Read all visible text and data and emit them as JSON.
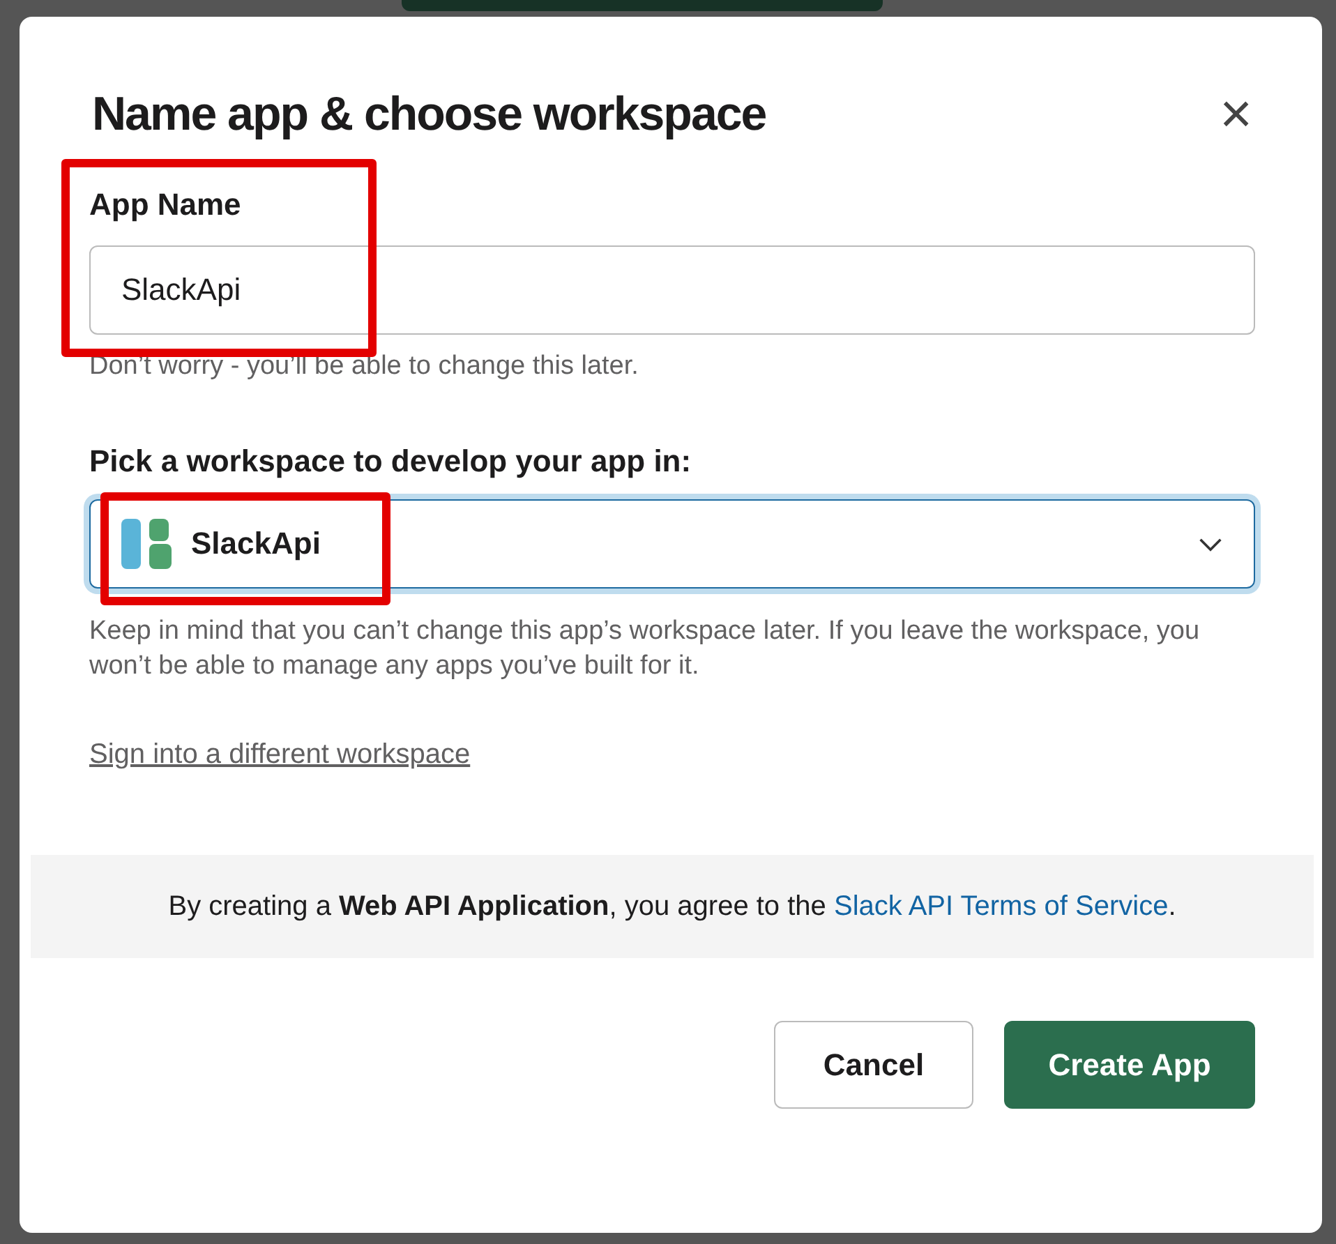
{
  "dialog": {
    "title": "Name app & choose workspace",
    "close": "×"
  },
  "app_name": {
    "label": "App Name",
    "value": "SlackApi",
    "hint": "Don’t worry - you’ll be able to change this later."
  },
  "workspace": {
    "label": "Pick a workspace to develop your app in:",
    "value": "SlackApi",
    "focused": true,
    "help": "Keep in mind that you can’t change this app’s workspace later. If you leave the workspace, you won’t be able to manage any apps you’ve built for it.",
    "link": "Sign into a different workspace"
  },
  "terms": {
    "before": "By creating a **Web API Application**, you agree to the",
    "link": "Slack API Terms of Service",
    "after": "."
  },
  "buttons": [
    {
      "label": "Cancel",
      "kind": "secondary"
    },
    {
      "label": "Create App",
      "kind": "primary"
    }
  ]
}
